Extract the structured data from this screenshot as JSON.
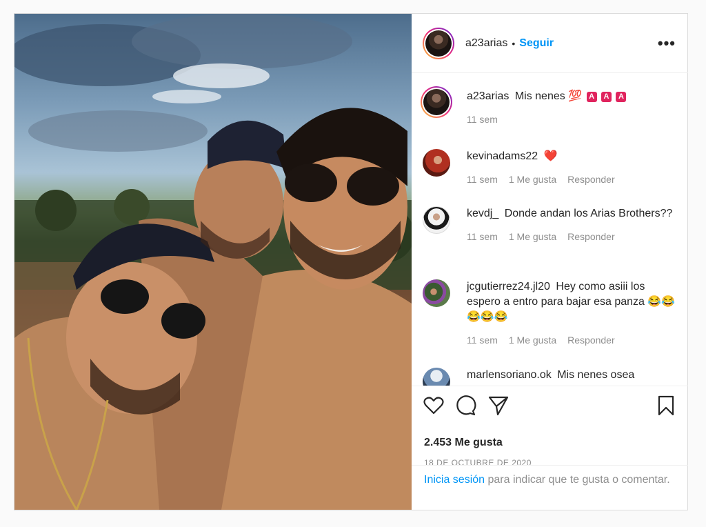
{
  "post": {
    "author": "a23arias",
    "follow_label": "Seguir",
    "dot": "•",
    "more_label": "•••",
    "caption": {
      "user": "a23arias",
      "text": "Mis nenes 💯",
      "badges": [
        "A",
        "A",
        "A"
      ],
      "time": "11 sem"
    },
    "comments": [
      {
        "user": "kevinadams22",
        "text": "❤️",
        "time": "11 sem",
        "likes": "1 Me gusta",
        "reply": "Responder",
        "avatar_color": "#b03020"
      },
      {
        "user": "kevdj_",
        "text": "Donde andan los Arias Brothers??",
        "time": "11 sem",
        "likes": "1 Me gusta",
        "reply": "Responder",
        "avatar_color": "#d8d8d8"
      },
      {
        "user": "jcgutierrez24.jl20",
        "text": "Hey como asiii los espero a entro para bajar esa panza 😂😂😂😂😂",
        "time": "11 sem",
        "likes": "1 Me gusta",
        "reply": "Responder",
        "avatar_color": "#5a7a4a"
      },
      {
        "user": "marlensoriano.ok",
        "text": "Mis nenes osea",
        "avatar_color": "#6a8ab0"
      }
    ],
    "likes_count": "2.453 Me gusta",
    "date": "18 DE OCTUBRE DE 2020",
    "login": {
      "link": "Inicia sesión",
      "rest": "para indicar que te gusta o comentar."
    }
  },
  "icons": {
    "like": "heart-icon",
    "comment": "comment-icon",
    "share": "share-icon",
    "save": "bookmark-icon"
  }
}
